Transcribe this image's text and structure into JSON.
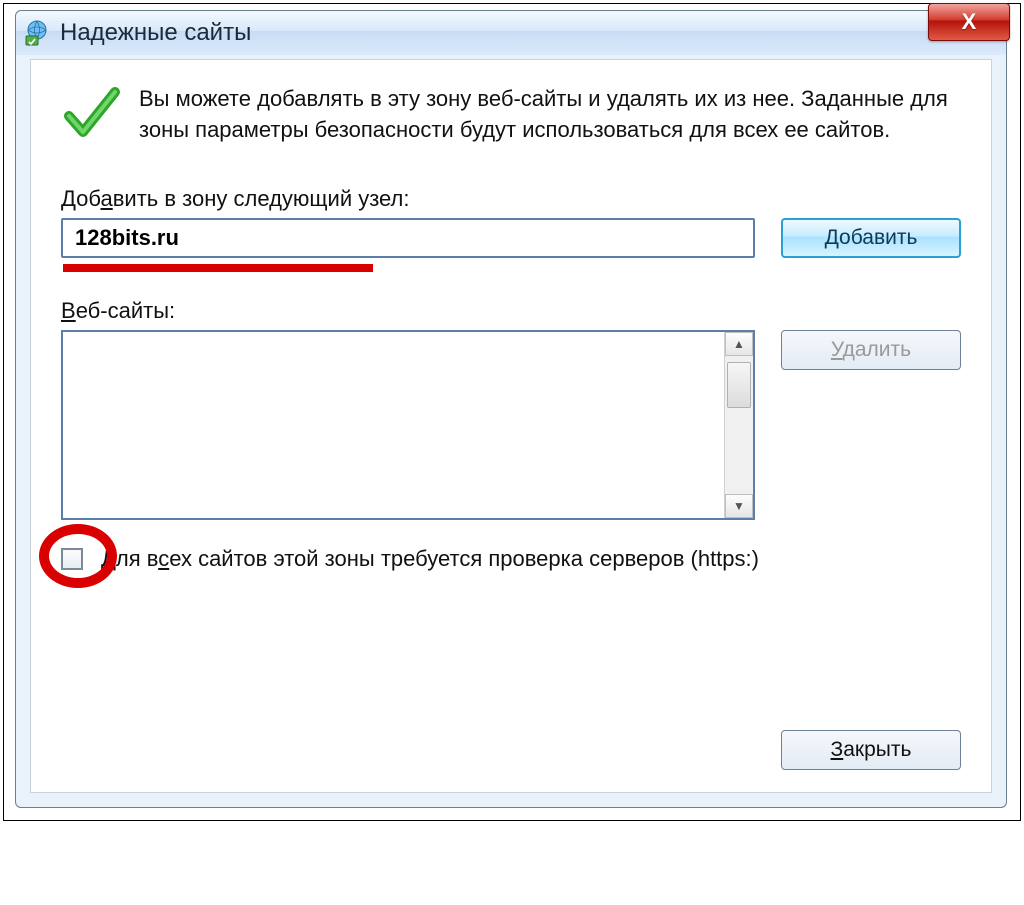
{
  "window": {
    "title": "Надежные сайты",
    "close_label": "X"
  },
  "info": {
    "text": "Вы можете добавлять в эту зону веб-сайты и удалять их из нее. Заданные для зоны параметры безопасности будут использоваться для всех ее сайтов."
  },
  "add": {
    "label_pre": "Доб",
    "label_u": "а",
    "label_post": "вить в зону следующий узел:",
    "input_value": "128bits.ru",
    "button_pre": "",
    "button_u": "Д",
    "button_post": "обавить"
  },
  "sites": {
    "label_u": "В",
    "label_post": "еб-сайты:",
    "remove_pre": "",
    "remove_u": "У",
    "remove_post": "далить"
  },
  "https_check": {
    "label_pre": "Для в",
    "label_u": "с",
    "label_post": "ех сайтов этой зоны требуется проверка серверов (https:)",
    "checked": false
  },
  "footer": {
    "close_pre": "",
    "close_u": "З",
    "close_post": "акрыть"
  }
}
